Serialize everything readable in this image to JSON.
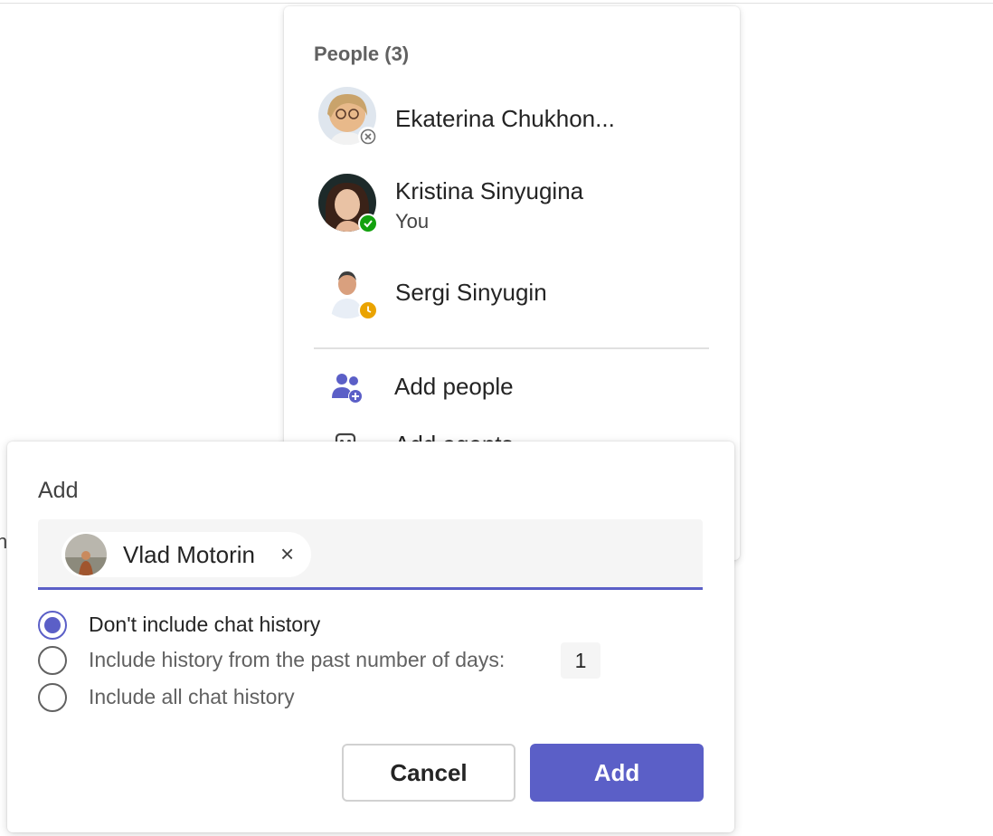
{
  "background": {
    "edge_fragment": "n"
  },
  "people_panel": {
    "title": "People (3)",
    "people": [
      {
        "name": "Ekaterina Chukhon...",
        "subtitle": "",
        "presence": "offline-icon"
      },
      {
        "name": "Kristina Sinyugina",
        "subtitle": "You",
        "presence": "available-icon"
      },
      {
        "name": "Sergi Sinyugin",
        "subtitle": "",
        "presence": "away-icon"
      }
    ],
    "actions": [
      {
        "label": "Add people",
        "icon": "add-people-icon"
      },
      {
        "label": "Add agents",
        "icon": "agent-icon"
      }
    ]
  },
  "add_dialog": {
    "title": "Add",
    "selected_person": {
      "name": "Vlad Motorin",
      "remove_glyph": "×"
    },
    "history_options": [
      {
        "label": "Don't include chat history",
        "checked": true
      },
      {
        "label": "Include history from the past number of days:",
        "checked": false,
        "days_value": "1"
      },
      {
        "label": "Include all chat history",
        "checked": false
      }
    ],
    "cancel_label": "Cancel",
    "add_label": "Add"
  },
  "colors": {
    "accent": "#5b5fc7",
    "presence_available": "#13a10e",
    "presence_away": "#eaa300",
    "presence_offline": "#8a8a8a"
  }
}
